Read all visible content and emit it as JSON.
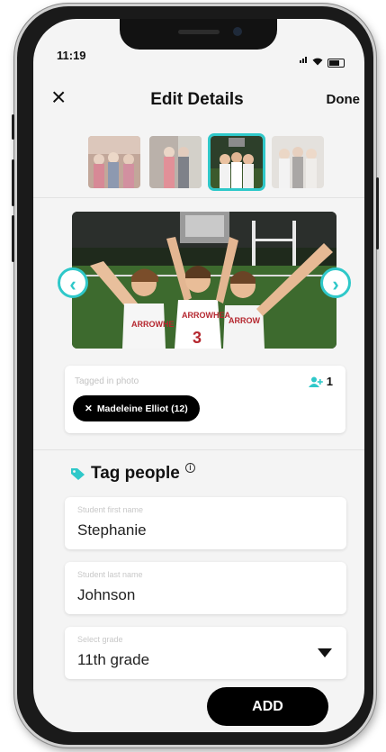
{
  "status_bar": {
    "time": "11:19",
    "icons": [
      "signal-icon",
      "wifi-icon",
      "battery-icon"
    ]
  },
  "header": {
    "close_icon": "×",
    "title": "Edit Details",
    "done_label": "Done"
  },
  "thumbnails": [
    {
      "name": "photo-thumbnail-1",
      "selected": false
    },
    {
      "name": "photo-thumbnail-2",
      "selected": false
    },
    {
      "name": "photo-thumbnail-3",
      "selected": true
    },
    {
      "name": "photo-thumbnail-4",
      "selected": false
    }
  ],
  "carousel": {
    "prev_icon": "‹",
    "next_icon": "›"
  },
  "tagged": {
    "label": "Tagged in photo",
    "count": "1",
    "chips": [
      {
        "remove_icon": "✕",
        "text": "Madeleine Elliot (12)"
      }
    ]
  },
  "tag_people": {
    "title": "Tag people",
    "info_icon": "i",
    "first_name": {
      "placeholder": "Student first name",
      "value": "Stephanie"
    },
    "last_name": {
      "placeholder": "Student last name",
      "value": "Johnson"
    },
    "grade": {
      "placeholder": "Select grade",
      "value": "11th grade"
    }
  },
  "add_button": {
    "label": "ADD"
  },
  "colors": {
    "accent": "#2fc8c9",
    "dark": "#000000",
    "background": "#f4f4f4"
  }
}
